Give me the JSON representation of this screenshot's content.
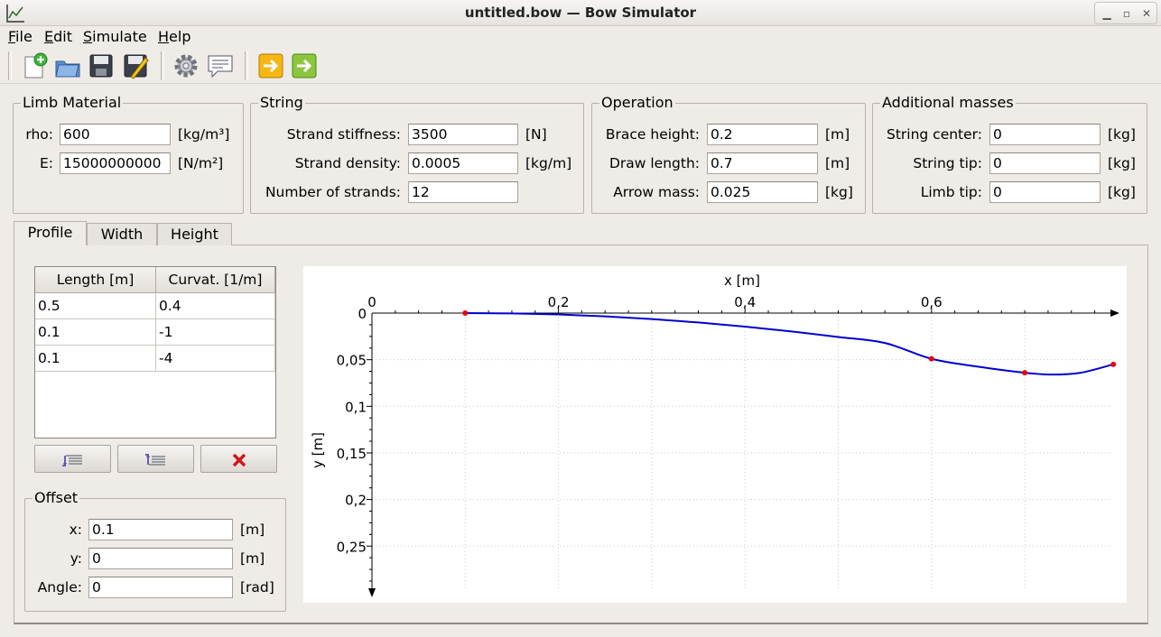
{
  "window": {
    "title": "untitled.bow — Bow Simulator"
  },
  "menu": [
    {
      "label": "File",
      "accel": "F",
      "rest": "ile"
    },
    {
      "label": "Edit",
      "accel": "E",
      "rest": "dit"
    },
    {
      "label": "Simulate",
      "accel": "S",
      "rest": "imulate"
    },
    {
      "label": "Help",
      "accel": "H",
      "rest": "elp"
    }
  ],
  "toolbar": {
    "icons": [
      "new-file-icon",
      "open-folder-icon",
      "save-icon",
      "save-as-icon",
      "settings-gear-icon",
      "comment-icon",
      "run-static-arrow-icon",
      "run-dynamic-arrow-icon"
    ]
  },
  "limb_material": {
    "title": "Limb Material",
    "rho": {
      "label": "rho:",
      "value": "600",
      "unit": "[kg/m³]"
    },
    "E": {
      "label": "E:",
      "value": "15000000000",
      "unit": "[N/m²]"
    }
  },
  "string": {
    "title": "String",
    "stiffness": {
      "label": "Strand stiffness:",
      "value": "3500",
      "unit": "[N]"
    },
    "density": {
      "label": "Strand density:",
      "value": "0.0005",
      "unit": "[kg/m]"
    },
    "strands": {
      "label": "Number of strands:",
      "value": "12"
    }
  },
  "operation": {
    "title": "Operation",
    "brace": {
      "label": "Brace height:",
      "value": "0.2",
      "unit": "[m]"
    },
    "draw": {
      "label": "Draw length:",
      "value": "0.7",
      "unit": "[m]"
    },
    "arrow": {
      "label": "Arrow mass:",
      "value": "0.025",
      "unit": "[kg]"
    }
  },
  "masses": {
    "title": "Additional masses",
    "center": {
      "label": "String center:",
      "value": "0",
      "unit": "[kg]"
    },
    "tip": {
      "label": "String tip:",
      "value": "0",
      "unit": "[kg]"
    },
    "limb": {
      "label": "Limb tip:",
      "value": "0",
      "unit": "[kg]"
    }
  },
  "tabs": [
    {
      "label": "Profile",
      "active": true
    },
    {
      "label": "Width",
      "active": false
    },
    {
      "label": "Height",
      "active": false
    }
  ],
  "segments": {
    "headers": [
      "Length [m]",
      "Curvat. [1/m]"
    ],
    "rows": [
      [
        "0.5",
        "0.4"
      ],
      [
        "0.1",
        "-1"
      ],
      [
        "0.1",
        "-4"
      ]
    ]
  },
  "segment_buttons": [
    "insert-below-icon",
    "insert-above-icon",
    "delete-icon"
  ],
  "offset": {
    "title": "Offset",
    "x": {
      "label": "x:",
      "value": "0.1",
      "unit": "[m]"
    },
    "y": {
      "label": "y:",
      "value": "0",
      "unit": "[m]"
    },
    "angle": {
      "label": "Angle:",
      "value": "0",
      "unit": "[rad]"
    }
  },
  "chart_data": {
    "type": "line",
    "xlabel": "x [m]",
    "ylabel": "y [m]",
    "xlim": [
      0,
      0.8
    ],
    "ylim": [
      0,
      0.3
    ],
    "y_inverted": true,
    "x_axis_position": "top",
    "grid": true,
    "xticks": [
      0,
      0.2,
      0.4,
      0.6
    ],
    "xtick_labels": [
      "0",
      "0,2",
      "0,4",
      "0,6"
    ],
    "yticks": [
      0,
      0.05,
      0.1,
      0.15,
      0.2,
      0.25
    ],
    "ytick_labels": [
      "0",
      "0,05",
      "0,1",
      "0,15",
      "0,2",
      "0,25"
    ],
    "series": [
      {
        "x": [
          0.1,
          0.15,
          0.2,
          0.25,
          0.3,
          0.35,
          0.4,
          0.45,
          0.5,
          0.55,
          0.6,
          0.65,
          0.7,
          0.73,
          0.76,
          0.795
        ],
        "y": [
          0,
          0.0004,
          0.0015,
          0.0035,
          0.0064,
          0.0101,
          0.0145,
          0.0197,
          0.0256,
          0.0321,
          0.049,
          0.0575,
          0.064,
          0.066,
          0.064,
          0.055
        ],
        "color": "#0000cc"
      }
    ],
    "points": {
      "x": [
        0.1,
        0.6,
        0.7,
        0.795
      ],
      "y": [
        0,
        0.049,
        0.064,
        0.055
      ],
      "color": "#e8000d"
    }
  }
}
